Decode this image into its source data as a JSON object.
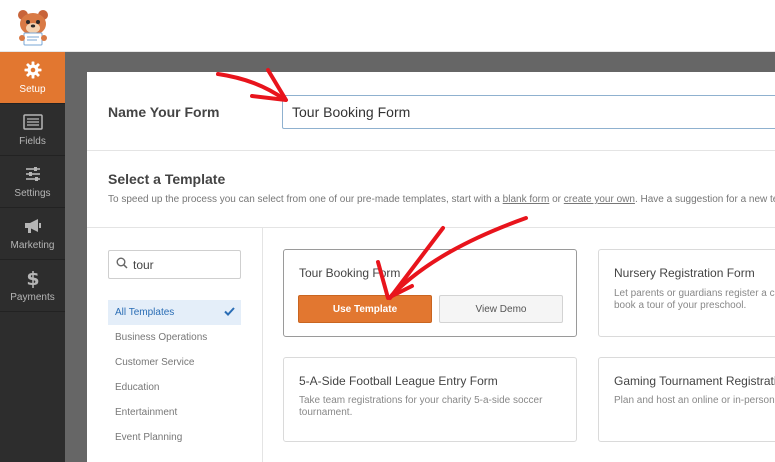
{
  "sidebar": {
    "items": [
      {
        "label": "Setup",
        "icon": "gear-icon",
        "active": true
      },
      {
        "label": "Fields",
        "icon": "fields-icon",
        "active": false
      },
      {
        "label": "Settings",
        "icon": "sliders-icon",
        "active": false
      },
      {
        "label": "Marketing",
        "icon": "megaphone-icon",
        "active": false
      },
      {
        "label": "Payments",
        "icon": "dollar-icon",
        "active": false
      }
    ]
  },
  "form_name": {
    "label": "Name Your Form",
    "value": "Tour Booking Form"
  },
  "select_template": {
    "title": "Select a Template",
    "desc_before": "To speed up the process you can select from one of our pre-made templates, start with a ",
    "blank_form_link": "blank form",
    "desc_or": " or ",
    "create_own_link": "create your own",
    "desc_after": ". Have a suggestion for a new tem"
  },
  "search": {
    "value": "tour"
  },
  "categories": [
    {
      "label": "All Templates",
      "active": true
    },
    {
      "label": "Business Operations",
      "active": false
    },
    {
      "label": "Customer Service",
      "active": false
    },
    {
      "label": "Education",
      "active": false
    },
    {
      "label": "Entertainment",
      "active": false
    },
    {
      "label": "Event Planning",
      "active": false
    }
  ],
  "templates": [
    {
      "title": "Tour Booking Form",
      "use_label": "Use Template",
      "demo_label": "View Demo"
    },
    {
      "title": "Nursery Registration Form",
      "desc_line1": "Let parents or guardians register a ch",
      "desc_line2": "book a tour of your preschool."
    },
    {
      "title": "5-A-Side Football League Entry Form",
      "desc_line1": "Take team registrations for your charity 5-a-side soccer",
      "desc_line2": "tournament."
    },
    {
      "title": "Gaming Tournament Registratio",
      "desc_line1": "Plan and host an online or in-person"
    }
  ],
  "colors": {
    "accent": "#e27730",
    "sidebar_bg": "#2d2d2d",
    "annotation_arrow": "#e8141c"
  }
}
